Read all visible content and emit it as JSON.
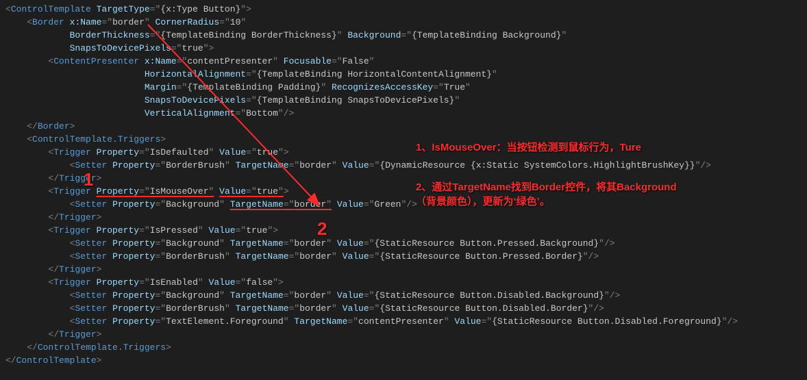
{
  "code": {
    "l1": "<ControlTemplate TargetType=\"{x:Type Button}\">",
    "l2": "    <Border x:Name=\"border\" CornerRadius=\"10\"",
    "l3": "            BorderThickness=\"{TemplateBinding BorderThickness}\" Background=\"{TemplateBinding Background}\"",
    "l4": "            SnapsToDevicePixels=\"true\">",
    "l5": "        <ContentPresenter x:Name=\"contentPresenter\" Focusable=\"False\"",
    "l6": "                          HorizontalAlignment=\"{TemplateBinding HorizontalContentAlignment}\"",
    "l7": "                          Margin=\"{TemplateBinding Padding}\" RecognizesAccessKey=\"True\"",
    "l8": "                          SnapsToDevicePixels=\"{TemplateBinding SnapsToDevicePixels}\"",
    "l9": "                          VerticalAlignment=\"Bottom\"/>",
    "l10": "    </Border>",
    "l11": "    <ControlTemplate.Triggers>",
    "l12": "        <Trigger Property=\"IsDefaulted\" Value=\"true\">",
    "l13": "            <Setter Property=\"BorderBrush\" TargetName=\"border\" Value=\"{DynamicResource {x:Static SystemColors.HighlightBrushKey}}\"/>",
    "l14": "        </Trigger>",
    "l15": "        <Trigger Property=\"IsMouseOver\" Value=\"true\">",
    "l16": "            <Setter Property=\"Background\" TargetName=\"border\" Value=\"Green\"/>",
    "l17": "        </Trigger>",
    "l18": "        <Trigger Property=\"IsPressed\" Value=\"true\">",
    "l19": "            <Setter Property=\"Background\" TargetName=\"border\" Value=\"{StaticResource Button.Pressed.Background}\"/>",
    "l20": "            <Setter Property=\"BorderBrush\" TargetName=\"border\" Value=\"{StaticResource Button.Pressed.Border}\"/>",
    "l21": "        </Trigger>",
    "l22": "        <Trigger Property=\"IsEnabled\" Value=\"false\">",
    "l23": "            <Setter Property=\"Background\" TargetName=\"border\" Value=\"{StaticResource Button.Disabled.Background}\"/>",
    "l24": "            <Setter Property=\"BorderBrush\" TargetName=\"border\" Value=\"{StaticResource Button.Disabled.Border}\"/>",
    "l25": "            <Setter Property=\"TextElement.Foreground\" TargetName=\"contentPresenter\" Value=\"{StaticResource Button.Disabled.Foreground}\"/>",
    "l26": "        </Trigger>",
    "l27": "    </ControlTemplate.Triggers>",
    "l28": "</ControlTemplate>"
  },
  "annotations": {
    "num1": "1",
    "num2": "2",
    "note1": "1、IsMouseOver：当按钮检测到鼠标行为，Ture",
    "note2a": "2、通过TargetName找到Border控件，将其Background",
    "note2b": "（背景颜色），更新为‘绿色’。"
  }
}
